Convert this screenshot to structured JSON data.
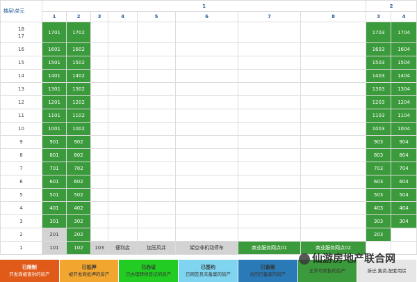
{
  "corner_label": "楼层\\单元",
  "building_groups": [
    {
      "label": "1"
    },
    {
      "label": "2"
    }
  ],
  "columns": [
    "1",
    "2",
    "3",
    "4",
    "5",
    "6",
    "7",
    "8",
    "3",
    "4"
  ],
  "floors": [
    {
      "label": "18\n17",
      "cells": [
        [
          "1701",
          "g"
        ],
        [
          "1702",
          "g"
        ],
        [
          "",
          "e"
        ],
        [
          "",
          "e"
        ],
        [
          "",
          "e"
        ],
        [
          "",
          "e"
        ],
        [
          "",
          "e"
        ],
        [
          "",
          "e"
        ],
        [
          "1703",
          "g"
        ],
        [
          "1704",
          "g"
        ]
      ]
    },
    {
      "label": "16",
      "cells": [
        [
          "1601",
          "g"
        ],
        [
          "1602",
          "g"
        ],
        [
          "",
          "e"
        ],
        [
          "",
          "e"
        ],
        [
          "",
          "e"
        ],
        [
          "",
          "e"
        ],
        [
          "",
          "e"
        ],
        [
          "",
          "e"
        ],
        [
          "1603",
          "g"
        ],
        [
          "1604",
          "g"
        ]
      ]
    },
    {
      "label": "15",
      "cells": [
        [
          "1501",
          "g"
        ],
        [
          "1502",
          "g"
        ],
        [
          "",
          "e"
        ],
        [
          "",
          "e"
        ],
        [
          "",
          "e"
        ],
        [
          "",
          "e"
        ],
        [
          "",
          "e"
        ],
        [
          "",
          "e"
        ],
        [
          "1503",
          "g"
        ],
        [
          "1504",
          "g"
        ]
      ]
    },
    {
      "label": "14",
      "cells": [
        [
          "1401",
          "g"
        ],
        [
          "1402",
          "g"
        ],
        [
          "",
          "e"
        ],
        [
          "",
          "e"
        ],
        [
          "",
          "e"
        ],
        [
          "",
          "e"
        ],
        [
          "",
          "e"
        ],
        [
          "",
          "e"
        ],
        [
          "1403",
          "g"
        ],
        [
          "1404",
          "g"
        ]
      ]
    },
    {
      "label": "13",
      "cells": [
        [
          "1301",
          "g"
        ],
        [
          "1302",
          "g"
        ],
        [
          "",
          "e"
        ],
        [
          "",
          "e"
        ],
        [
          "",
          "e"
        ],
        [
          "",
          "e"
        ],
        [
          "",
          "e"
        ],
        [
          "",
          "e"
        ],
        [
          "1303",
          "g"
        ],
        [
          "1304",
          "g"
        ]
      ]
    },
    {
      "label": "12",
      "cells": [
        [
          "1201",
          "g"
        ],
        [
          "1202",
          "g"
        ],
        [
          "",
          "e"
        ],
        [
          "",
          "e"
        ],
        [
          "",
          "e"
        ],
        [
          "",
          "e"
        ],
        [
          "",
          "e"
        ],
        [
          "",
          "e"
        ],
        [
          "1203",
          "g"
        ],
        [
          "1204",
          "g"
        ]
      ]
    },
    {
      "label": "11",
      "cells": [
        [
          "1101",
          "g"
        ],
        [
          "1102",
          "g"
        ],
        [
          "",
          "e"
        ],
        [
          "",
          "e"
        ],
        [
          "",
          "e"
        ],
        [
          "",
          "e"
        ],
        [
          "",
          "e"
        ],
        [
          "",
          "e"
        ],
        [
          "1103",
          "g"
        ],
        [
          "1104",
          "g"
        ]
      ]
    },
    {
      "label": "10",
      "cells": [
        [
          "1001",
          "g"
        ],
        [
          "1002",
          "g"
        ],
        [
          "",
          "e"
        ],
        [
          "",
          "e"
        ],
        [
          "",
          "e"
        ],
        [
          "",
          "e"
        ],
        [
          "",
          "e"
        ],
        [
          "",
          "e"
        ],
        [
          "1003",
          "g"
        ],
        [
          "1004",
          "g"
        ]
      ]
    },
    {
      "label": "9",
      "cells": [
        [
          "901",
          "g"
        ],
        [
          "902",
          "g"
        ],
        [
          "",
          "e"
        ],
        [
          "",
          "e"
        ],
        [
          "",
          "e"
        ],
        [
          "",
          "e"
        ],
        [
          "",
          "e"
        ],
        [
          "",
          "e"
        ],
        [
          "903",
          "g"
        ],
        [
          "904",
          "g"
        ]
      ]
    },
    {
      "label": "8",
      "cells": [
        [
          "801",
          "g"
        ],
        [
          "802",
          "g"
        ],
        [
          "",
          "e"
        ],
        [
          "",
          "e"
        ],
        [
          "",
          "e"
        ],
        [
          "",
          "e"
        ],
        [
          "",
          "e"
        ],
        [
          "",
          "e"
        ],
        [
          "803",
          "g"
        ],
        [
          "804",
          "g"
        ]
      ]
    },
    {
      "label": "7",
      "cells": [
        [
          "701",
          "g"
        ],
        [
          "702",
          "g"
        ],
        [
          "",
          "e"
        ],
        [
          "",
          "e"
        ],
        [
          "",
          "e"
        ],
        [
          "",
          "e"
        ],
        [
          "",
          "e"
        ],
        [
          "",
          "e"
        ],
        [
          "703",
          "g"
        ],
        [
          "704",
          "g"
        ]
      ]
    },
    {
      "label": "6",
      "cells": [
        [
          "601",
          "g"
        ],
        [
          "602",
          "g"
        ],
        [
          "",
          "e"
        ],
        [
          "",
          "e"
        ],
        [
          "",
          "e"
        ],
        [
          "",
          "e"
        ],
        [
          "",
          "e"
        ],
        [
          "",
          "e"
        ],
        [
          "603",
          "g"
        ],
        [
          "604",
          "g"
        ]
      ]
    },
    {
      "label": "5",
      "cells": [
        [
          "501",
          "g"
        ],
        [
          "502",
          "g"
        ],
        [
          "",
          "e"
        ],
        [
          "",
          "e"
        ],
        [
          "",
          "e"
        ],
        [
          "",
          "e"
        ],
        [
          "",
          "e"
        ],
        [
          "",
          "e"
        ],
        [
          "503",
          "g"
        ],
        [
          "504",
          "g"
        ]
      ]
    },
    {
      "label": "4",
      "cells": [
        [
          "401",
          "g"
        ],
        [
          "402",
          "g"
        ],
        [
          "",
          "e"
        ],
        [
          "",
          "e"
        ],
        [
          "",
          "e"
        ],
        [
          "",
          "e"
        ],
        [
          "",
          "e"
        ],
        [
          "",
          "e"
        ],
        [
          "403",
          "g"
        ],
        [
          "404",
          "g"
        ]
      ]
    },
    {
      "label": "3",
      "cells": [
        [
          "301",
          "g"
        ],
        [
          "302",
          "g"
        ],
        [
          "",
          "e"
        ],
        [
          "",
          "e"
        ],
        [
          "",
          "e"
        ],
        [
          "",
          "e"
        ],
        [
          "",
          "e"
        ],
        [
          "",
          "e"
        ],
        [
          "303",
          "g"
        ],
        [
          "304",
          "g"
        ]
      ]
    },
    {
      "label": "2",
      "cells": [
        [
          "201",
          "x"
        ],
        [
          "202",
          "g"
        ],
        [
          "",
          "e"
        ],
        [
          "",
          "e"
        ],
        [
          "",
          "e"
        ],
        [
          "",
          "e"
        ],
        [
          "",
          "e"
        ],
        [
          "",
          "e"
        ],
        [
          "203",
          "g"
        ],
        [
          "",
          "e"
        ]
      ]
    },
    {
      "label": "1",
      "cells": [
        [
          "101",
          "x"
        ],
        [
          "102",
          "g"
        ],
        [
          "103",
          "x"
        ],
        [
          "便利店",
          "x"
        ],
        [
          "加压风井",
          "x"
        ],
        [
          "架空非机动停车",
          "x"
        ],
        [
          "商业服务网点01",
          "g"
        ],
        [
          "商业服务网点02",
          "g"
        ],
        [
          "",
          "e"
        ],
        [
          "",
          "e"
        ]
      ]
    }
  ],
  "legend": [
    {
      "title": "已限制",
      "desc": "开发商被查封的房产",
      "bg": "#e05a1a",
      "fg": "#ffffff"
    },
    {
      "title": "已抵押",
      "desc": "被开发商抵押的房产",
      "bg": "#f2a630",
      "fg": "#333333"
    },
    {
      "title": "已办证",
      "desc": "已办理转移登记的房产",
      "bg": "#22cc22",
      "fg": "#333333"
    },
    {
      "title": "已签约",
      "desc": "已网签且未备案的房产",
      "bg": "#7fd4f0",
      "fg": "#333333"
    },
    {
      "title": "已备案",
      "desc": "合同已备案的房产",
      "bg": "#2a7ab8",
      "fg": "#333333"
    },
    {
      "title": "",
      "desc": "正常可销售的房产",
      "bg": "#3b9a3b",
      "fg": "#333333"
    },
    {
      "title": "",
      "desc": "拆迁,集资,配套用房",
      "bg": "#e6e6e6",
      "fg": "#333333"
    }
  ],
  "watermark": "仙游房地产联合网",
  "colors": {
    "green": "#3b9a3b",
    "gray": "#d3d3d3",
    "header_text": "#2a5d9a"
  }
}
